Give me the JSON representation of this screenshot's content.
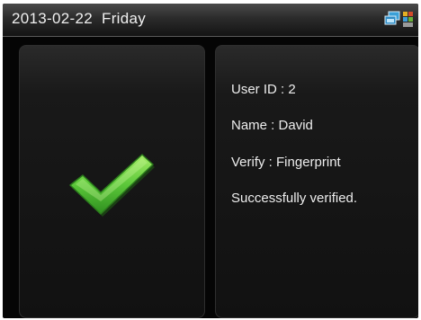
{
  "status_bar": {
    "date_text": "2013-02-22  Friday",
    "icons": [
      "network-icon",
      "device-status-icon"
    ]
  },
  "result": {
    "icon": "check-icon",
    "icon_color": "#5cc83a",
    "user_id": "User ID : 2",
    "name": "Name : David",
    "verify": "Verify : Fingerprint",
    "message": "Successfully verified."
  },
  "colors": {
    "background": "#050505",
    "panel": "#161616",
    "text": "#ededed"
  }
}
